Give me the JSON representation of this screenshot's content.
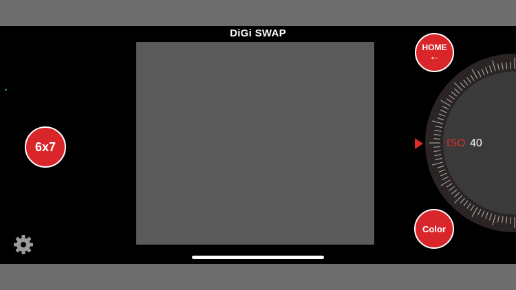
{
  "app": {
    "title": "DiGi SWAP"
  },
  "buttons": {
    "format_label": "6x7",
    "home_label": "HOME",
    "home_arrow": "←",
    "color_label": "Color"
  },
  "dial": {
    "iso_label": "ISO",
    "iso_value": "40"
  },
  "colors": {
    "accent": "#d8262a",
    "screen": "#000000",
    "viewfinder": "#5a5a5a",
    "frame": "#6e6e6e"
  },
  "icons": {
    "settings": "gear-icon",
    "dial_pointer": "triangle-right-icon"
  }
}
